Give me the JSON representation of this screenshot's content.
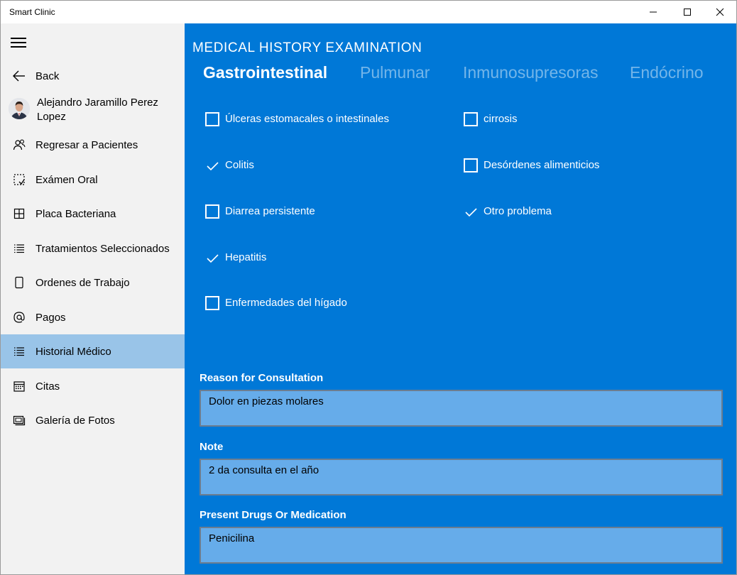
{
  "window": {
    "title": "Smart Clinic"
  },
  "sidebar": {
    "back_label": "Back",
    "user_name": "Alejandro Jaramillo Perez Lopez",
    "items": [
      {
        "label": "Regresar a Pacientes",
        "icon": "people-icon"
      },
      {
        "label": "Exámen Oral",
        "icon": "oral-exam-icon"
      },
      {
        "label": "Placa Bacteriana",
        "icon": "grid-icon"
      },
      {
        "label": "Tratamientos Seleccionados",
        "icon": "list-icon"
      },
      {
        "label": "Ordenes de Trabajo",
        "icon": "phone-icon"
      },
      {
        "label": "Pagos",
        "icon": "at-icon"
      },
      {
        "label": "Historial Médico",
        "icon": "list-icon",
        "selected": true
      },
      {
        "label": "Citas",
        "icon": "calendar-icon"
      },
      {
        "label": "Galería de Fotos",
        "icon": "photos-icon"
      }
    ]
  },
  "main": {
    "title": "MEDICAL HISTORY EXAMINATION",
    "tabs": [
      {
        "label": "Gastrointestinal",
        "active": true
      },
      {
        "label": "Pulmunar",
        "active": false
      },
      {
        "label": "Inmunosupresoras",
        "active": false
      },
      {
        "label": "Endócrino",
        "active": false
      }
    ],
    "conditions_left": [
      {
        "label": "Úlceras estomacales o intestinales",
        "checked": false
      },
      {
        "label": "Colitis",
        "checked": true
      },
      {
        "label": "Diarrea persistente",
        "checked": false
      },
      {
        "label": "Hepatitis",
        "checked": true
      },
      {
        "label": "Enfermedades del hígado",
        "checked": false
      }
    ],
    "conditions_right": [
      {
        "label": "cirrosis",
        "checked": false
      },
      {
        "label": "Desórdenes alimenticios",
        "checked": false
      },
      {
        "label": "Otro problema",
        "checked": true
      }
    ],
    "reason": {
      "label": "Reason for Consultation",
      "value": "Dolor en piezas molares"
    },
    "note": {
      "label": "Note",
      "value": "2 da consulta en el año"
    },
    "drugs": {
      "label": "Present Drugs Or Medication",
      "value": "Penicilina"
    }
  },
  "colors": {
    "accent": "#0078d7",
    "sidebar_bg": "#f2f2f2",
    "selected_bg": "#99c4e8",
    "field_bg": "#66acea"
  }
}
